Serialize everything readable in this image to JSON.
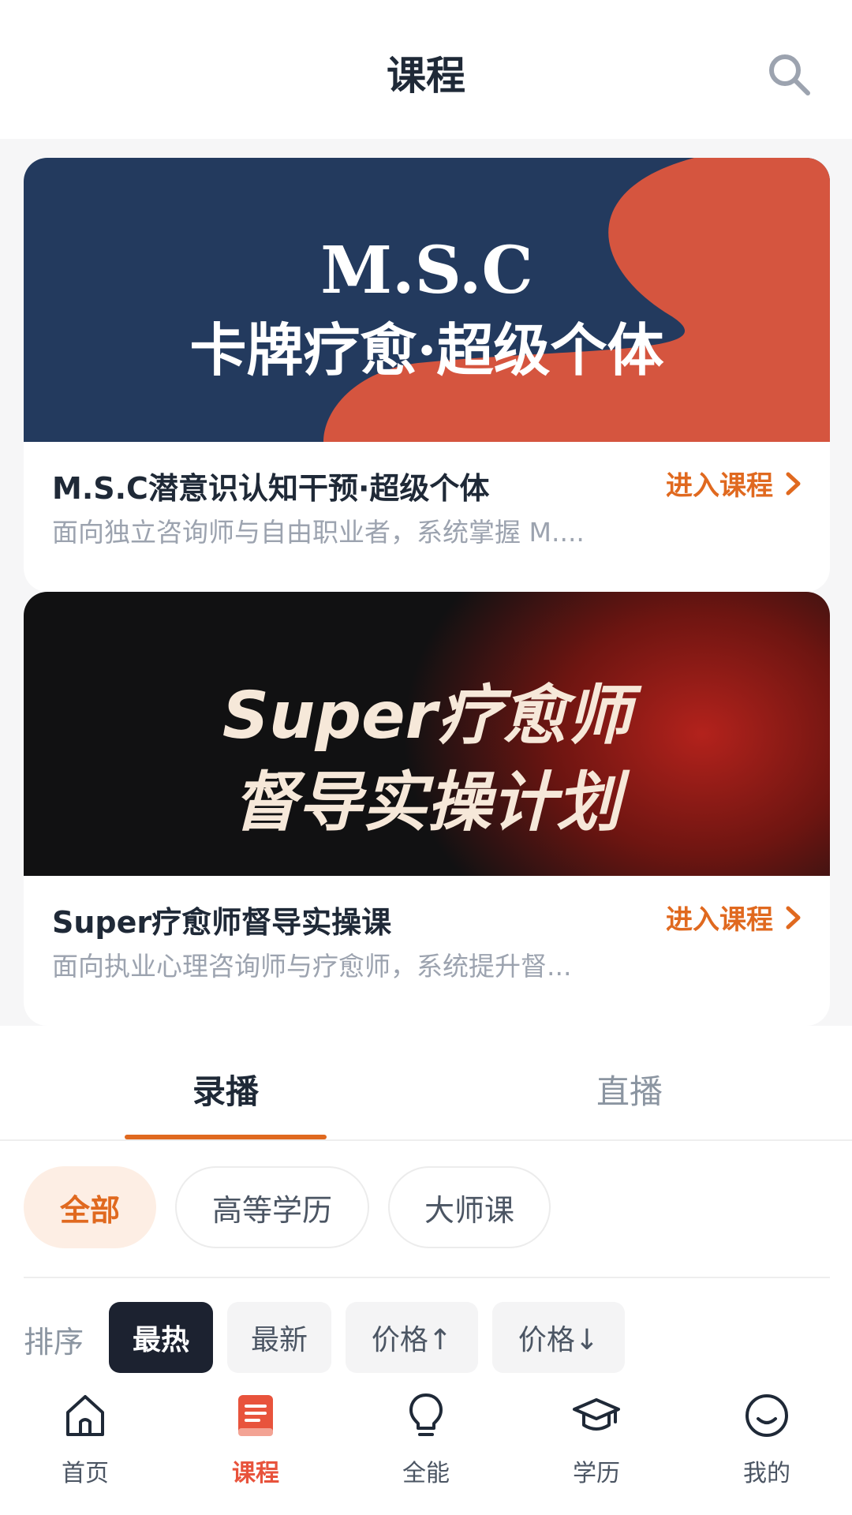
{
  "header": {
    "title": "课程",
    "search_icon": "search-icon"
  },
  "featured": [
    {
      "banner_line1": "M.S.C",
      "banner_line2": "卡牌疗愈·超级个体",
      "title": "M.S.C潜意识认知干预·超级个体",
      "desc": "面向独立咨询师与自由职业者，系统掌握 M....",
      "action": "进入课程",
      "colors": {
        "bg": "#233a5e",
        "accent": "#d5553f"
      }
    },
    {
      "banner_line1": "Super疗愈师",
      "banner_line2": "督导实操计划",
      "title": "Super疗愈师督导实操课",
      "desc": "面向执业心理咨询师与疗愈师，系统提升督...",
      "action": "进入课程",
      "colors": {
        "bg": "#111112",
        "accent": "#b3221c"
      }
    }
  ],
  "tabs": [
    {
      "label": "录播",
      "active": true
    },
    {
      "label": "直播",
      "active": false
    }
  ],
  "categories": [
    {
      "label": "全部",
      "active": true
    },
    {
      "label": "高等学历",
      "active": false
    },
    {
      "label": "大师课",
      "active": false
    }
  ],
  "sort": {
    "label": "排序",
    "options": [
      {
        "label": "最热",
        "active": true
      },
      {
        "label": "最新",
        "active": false
      },
      {
        "label": "价格↑",
        "active": false
      },
      {
        "label": "价格↓",
        "active": false
      }
    ]
  },
  "nav": [
    {
      "label": "首页",
      "icon": "home-icon",
      "active": false
    },
    {
      "label": "课程",
      "icon": "book-icon",
      "active": true
    },
    {
      "label": "全能",
      "icon": "lightbulb-icon",
      "active": false
    },
    {
      "label": "学历",
      "icon": "graduation-cap-icon",
      "active": false
    },
    {
      "label": "我的",
      "icon": "smiley-icon",
      "active": false
    }
  ],
  "colors": {
    "accent": "#e0691f",
    "nav_active": "#e8533c",
    "dark": "#1c2230"
  }
}
